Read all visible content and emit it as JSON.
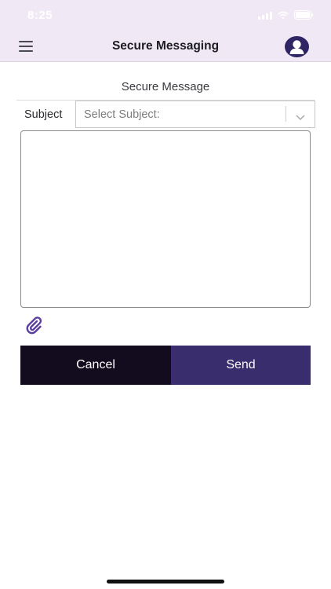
{
  "status_bar": {
    "time": "8:25"
  },
  "nav": {
    "title": "Secure Messaging"
  },
  "form": {
    "section_title": "Secure Message",
    "subject_label": "Subject",
    "subject_select_value": "Select Subject:",
    "message_value": ""
  },
  "actions": {
    "cancel_label": "Cancel",
    "send_label": "Send"
  },
  "colors": {
    "header_bg": "#f0e8f4",
    "cancel_bg": "#120c1e",
    "send_bg": "#3a2d6e",
    "profile_bg": "#2f2464",
    "attach_icon": "#5b3f9e"
  }
}
